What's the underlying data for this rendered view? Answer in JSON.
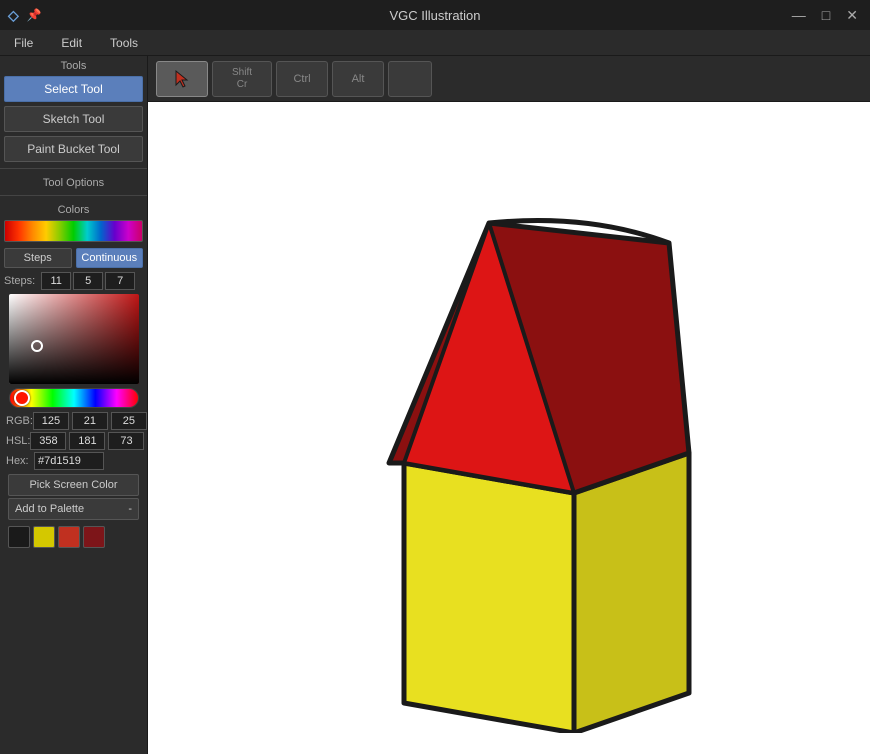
{
  "titlebar": {
    "title": "VGC Illustration",
    "logo": "V",
    "pin_icon": "📌",
    "minimize_icon": "—",
    "maximize_icon": "□",
    "close_icon": "✕"
  },
  "menubar": {
    "items": [
      "File",
      "Edit",
      "Tools"
    ]
  },
  "sidebar": {
    "tools_label": "Tools",
    "tool_options_label": "Tool Options",
    "select_tool": "Select Tool",
    "sketch_tool": "Sketch Tool",
    "paint_bucket_tool": "Paint Bucket Tool",
    "colors_label": "Colors",
    "steps_label": "Steps",
    "continuous_label": "Continuous",
    "steps_values": {
      "r": "11",
      "g": "5",
      "b": "7"
    },
    "rgb": {
      "label": "RGB:",
      "r": "125",
      "g": "21",
      "b": "25"
    },
    "hsl": {
      "label": "HSL:",
      "h": "358",
      "s": "181",
      "l": "73"
    },
    "hex": {
      "label": "Hex:",
      "value": "#7d1519"
    },
    "pick_screen_color": "Pick Screen Color",
    "add_to_palette": "Add to Palette",
    "add_shortcut": "-",
    "palette_colors": [
      "#1a1a1a",
      "#d4c800",
      "#c03020",
      "#7d1519"
    ]
  },
  "canvas_toolbar": {
    "buttons": [
      {
        "icon": "",
        "label": "",
        "active": true
      },
      {
        "icon": "Shift",
        "label": "Cr",
        "active": false
      },
      {
        "icon": "Ctrl",
        "label": "",
        "active": false
      },
      {
        "icon": "Alt",
        "label": "",
        "active": false
      },
      {
        "icon": "",
        "label": "",
        "active": false
      }
    ]
  }
}
